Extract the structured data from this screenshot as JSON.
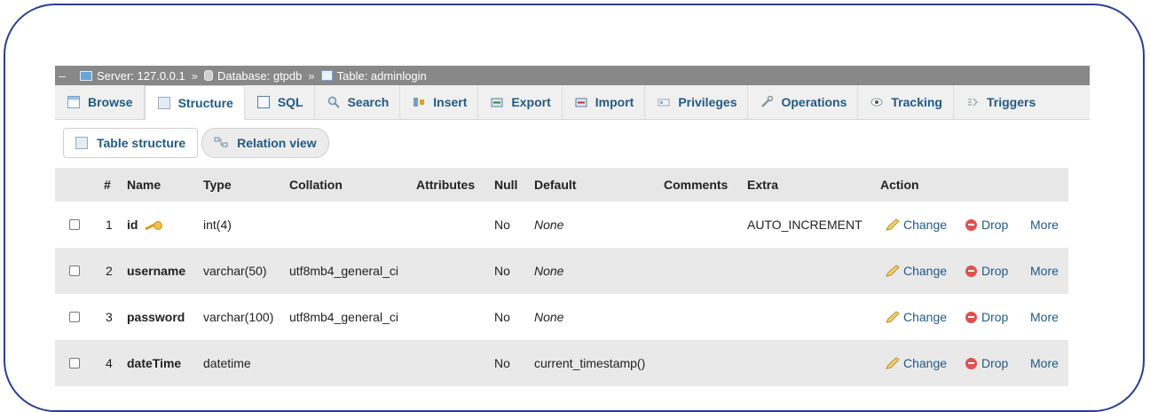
{
  "breadcrumb": {
    "server": "Server: 127.0.0.1",
    "database": "Database: gtpdb",
    "table": "Table: adminlogin",
    "separator": "»"
  },
  "tabs": [
    {
      "label": "Browse",
      "icon": "browse-icon"
    },
    {
      "label": "Structure",
      "icon": "structure-icon",
      "active": true
    },
    {
      "label": "SQL",
      "icon": "sql-icon"
    },
    {
      "label": "Search",
      "icon": "search-icon"
    },
    {
      "label": "Insert",
      "icon": "insert-icon"
    },
    {
      "label": "Export",
      "icon": "export-icon"
    },
    {
      "label": "Import",
      "icon": "import-icon"
    },
    {
      "label": "Privileges",
      "icon": "privileges-icon"
    },
    {
      "label": "Operations",
      "icon": "wrench-icon"
    },
    {
      "label": "Tracking",
      "icon": "eye-icon"
    },
    {
      "label": "Triggers",
      "icon": "triggers-icon"
    }
  ],
  "subtabs": [
    {
      "label": "Table structure",
      "active": true
    },
    {
      "label": "Relation view",
      "active": false
    }
  ],
  "table": {
    "headers": {
      "num": "#",
      "name": "Name",
      "type": "Type",
      "collation": "Collation",
      "attributes": "Attributes",
      "null": "Null",
      "default": "Default",
      "comments": "Comments",
      "extra": "Extra",
      "action": "Action"
    },
    "rows": [
      {
        "num": "1",
        "name": "id",
        "type": "int(4)",
        "collation": "",
        "null": "No",
        "default": "None",
        "extra": "AUTO_INCREMENT",
        "change": "Change",
        "drop": "Drop",
        "more": "More"
      },
      {
        "num": "2",
        "name": "username",
        "type": "varchar(50)",
        "collation": "utf8mb4_general_ci",
        "null": "No",
        "default": "None",
        "extra": "",
        "change": "Change",
        "drop": "Drop",
        "more": "More"
      },
      {
        "num": "3",
        "name": "password",
        "type": "varchar(100)",
        "collation": "utf8mb4_general_ci",
        "null": "No",
        "default": "None",
        "extra": "",
        "change": "Change",
        "drop": "Drop",
        "more": "More"
      },
      {
        "num": "4",
        "name": "dateTime",
        "type": "datetime",
        "collation": "",
        "null": "No",
        "default": "current_timestamp()",
        "extra": "",
        "change": "Change",
        "drop": "Drop",
        "more": "More"
      }
    ]
  },
  "colors": {
    "link": "#235a81",
    "frame": "#2a3f8f",
    "breadcrumb_bg": "#888888",
    "drop_icon": "#e05050"
  }
}
